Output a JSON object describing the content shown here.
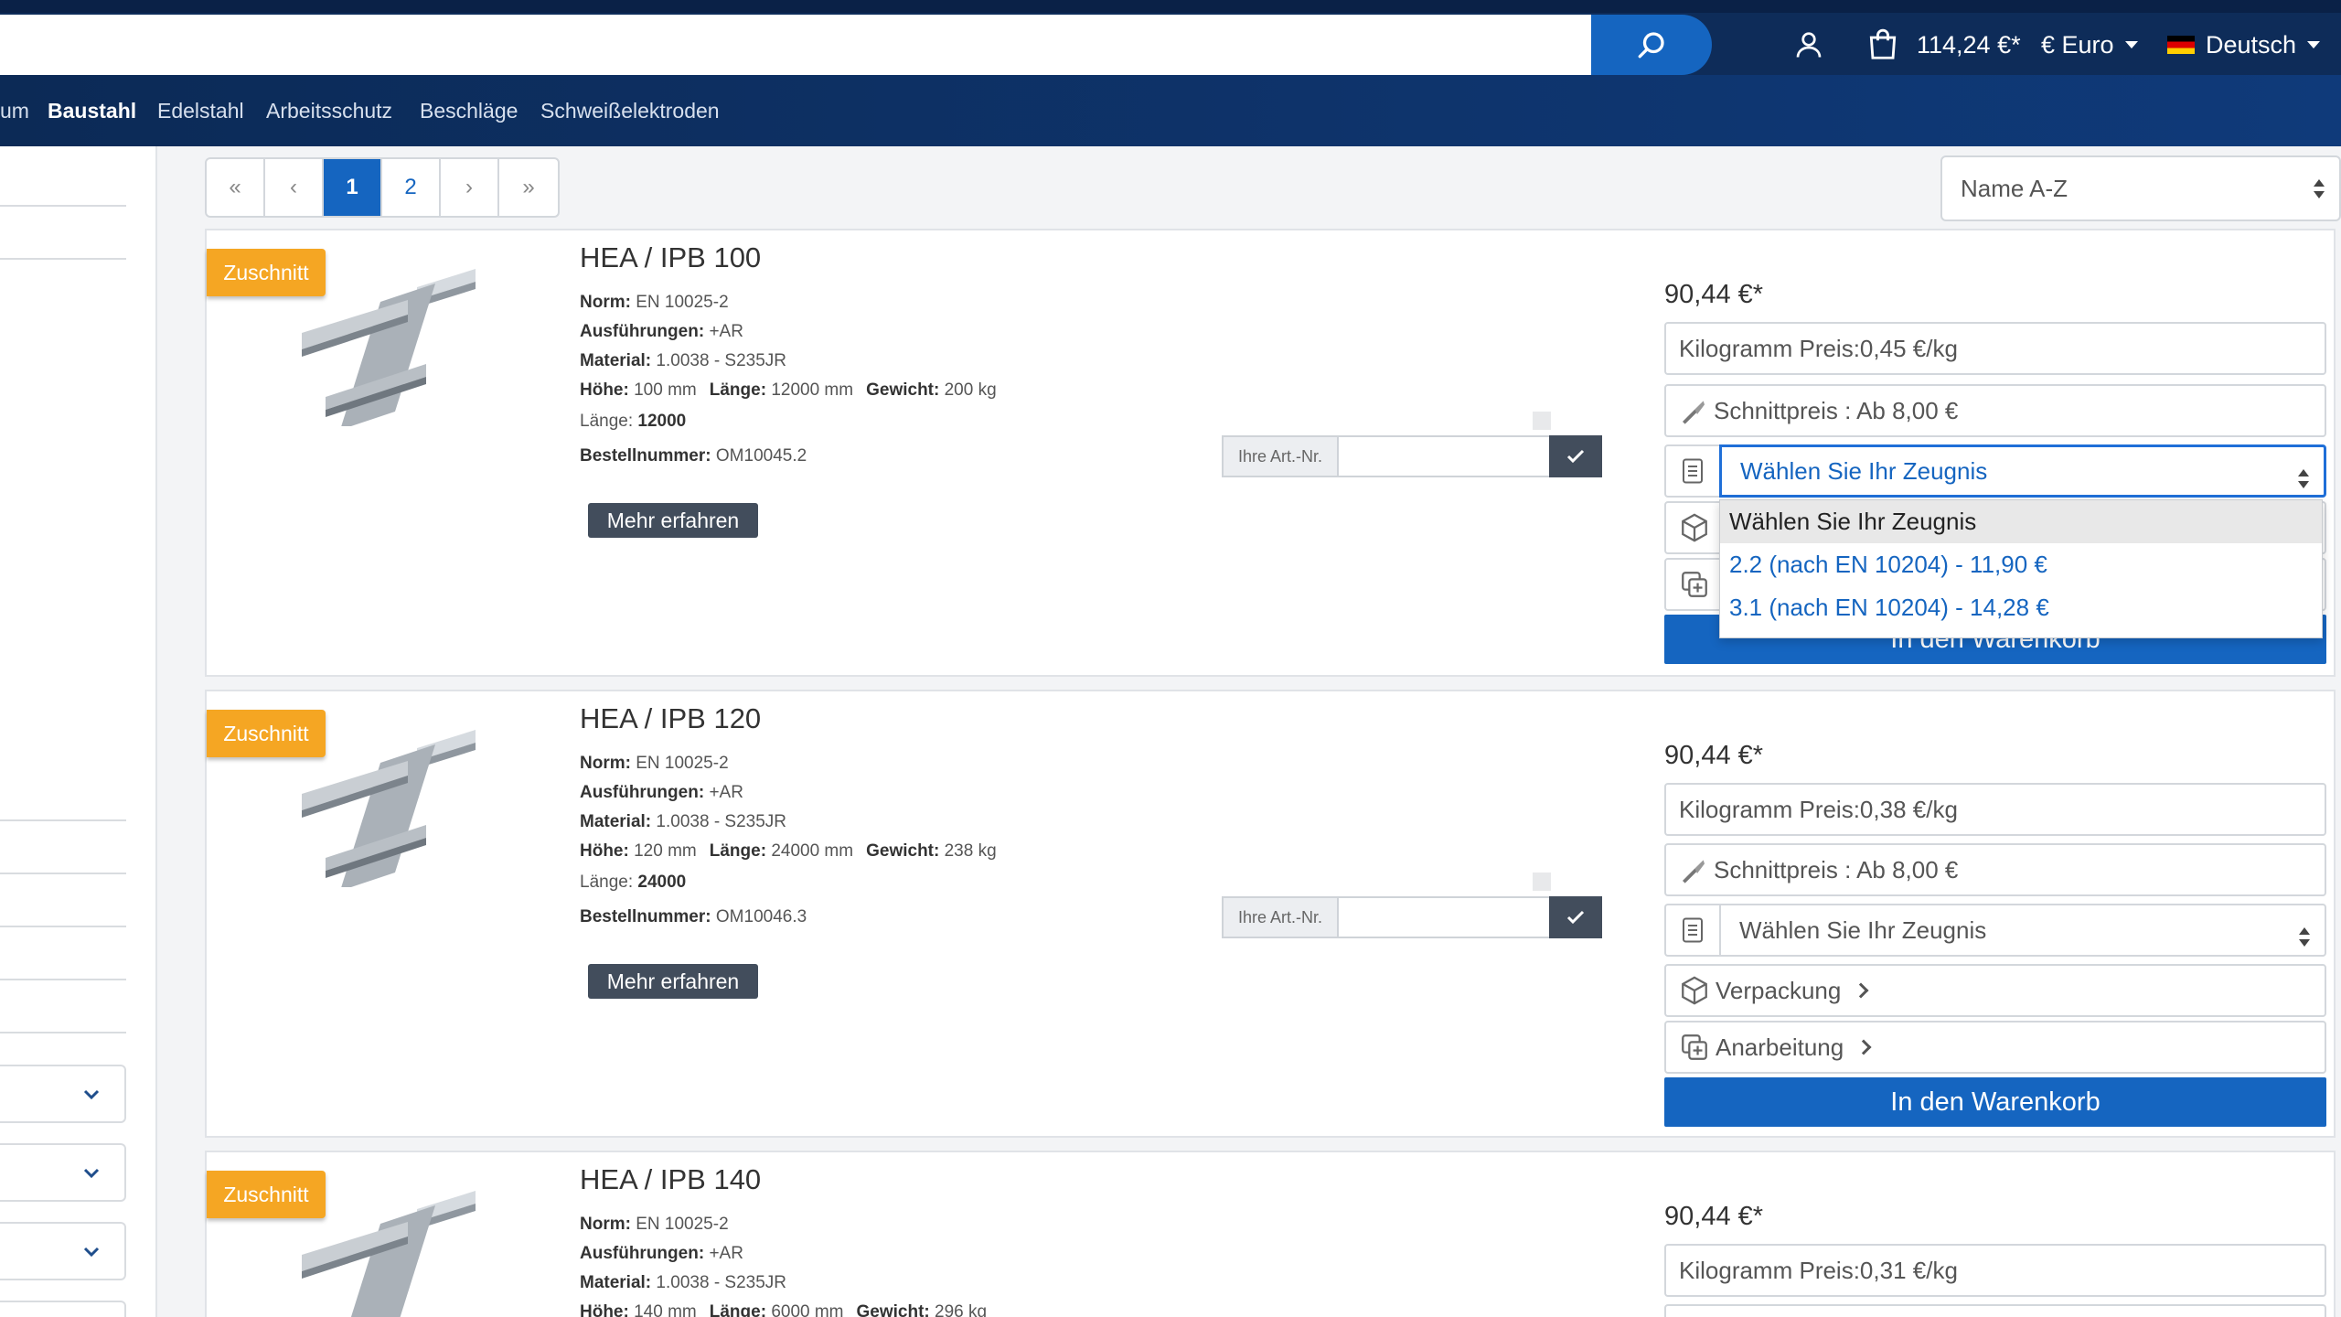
{
  "header": {
    "search_placeholder": "",
    "cart_total": "114,24 €*",
    "currency": "€ Euro",
    "language": "Deutsch"
  },
  "nav": {
    "items": [
      {
        "label": "um",
        "active": false
      },
      {
        "label": "Baustahl",
        "active": true
      },
      {
        "label": "Edelstahl",
        "active": false
      },
      {
        "label": "Arbeitsschutz",
        "active": false
      },
      {
        "label": "Beschläge",
        "active": false
      },
      {
        "label": "Schweißelektroden",
        "active": false
      }
    ]
  },
  "pagination": {
    "first": "«",
    "prev": "‹",
    "pages": [
      "1",
      "2"
    ],
    "current": "1",
    "next": "›",
    "last": "»"
  },
  "sort": {
    "selected": "Name A-Z"
  },
  "labels": {
    "badge": "Zuschnitt",
    "norm": "Norm:",
    "ausfuehrungen": "Ausführungen:",
    "material": "Material:",
    "hoehe": "Höhe:",
    "laenge": "Länge:",
    "gewicht": "Gewicht:",
    "laenge2": "Länge:",
    "bestellnummer": "Bestellnummer:",
    "mehr_erfahren": "Mehr erfahren",
    "artnr": "Ihre Art.-Nr.",
    "schnittpreis": "Schnittpreis : Ab 8,00 €",
    "zeugnis": "Wählen Sie Ihr Zeugnis",
    "verpackung": "Verpackung",
    "anarbeitung": "Anarbeitung",
    "warenkorb": "In den Warenkorb"
  },
  "colors": {
    "header_bg": "#0e2c59",
    "accent": "#1565c0",
    "badge": "#f5a623",
    "dark_button": "#424d5c"
  },
  "products": [
    {
      "title": "HEA / IPB 100",
      "norm": "EN 10025-2",
      "ausfuehrungen": "+AR",
      "material": "1.0038 - S235JR",
      "hoehe": "100 mm",
      "laenge": "12000 mm",
      "gewicht": "200 kg",
      "laenge_value": "12000",
      "bestellnummer": "OM10045.2",
      "price": "90,44 €*",
      "kg_price": "Kilogramm Preis:0,45 €/kg"
    },
    {
      "title": "HEA / IPB 120",
      "norm": "EN 10025-2",
      "ausfuehrungen": "+AR",
      "material": "1.0038 - S235JR",
      "hoehe": "120 mm",
      "laenge": "24000 mm",
      "gewicht": "238 kg",
      "laenge_value": "24000",
      "bestellnummer": "OM10046.3",
      "price": "90,44 €*",
      "kg_price": "Kilogramm Preis:0,38 €/kg"
    },
    {
      "title": "HEA / IPB 140",
      "norm": "EN 10025-2",
      "ausfuehrungen": "+AR",
      "material": "1.0038 - S235JR",
      "hoehe": "140 mm",
      "laenge": "6000 mm",
      "gewicht": "296 kg",
      "price": "90,44 €*",
      "kg_price": "Kilogramm Preis:0,31 €/kg"
    }
  ],
  "zeugnis_dropdown": {
    "options": [
      "Wählen Sie Ihr Zeugnis",
      "2.2 (nach EN 10204) - 11,90 €",
      "3.1 (nach EN 10204) - 14,28 €"
    ]
  },
  "icons": {
    "search": "search-icon",
    "user": "user-icon",
    "cart": "shopping-bag-icon",
    "flag": "german-flag-icon",
    "knife": "knife-icon",
    "document": "document-icon",
    "package": "package-icon",
    "add": "add-document-icon",
    "check": "check-icon"
  }
}
